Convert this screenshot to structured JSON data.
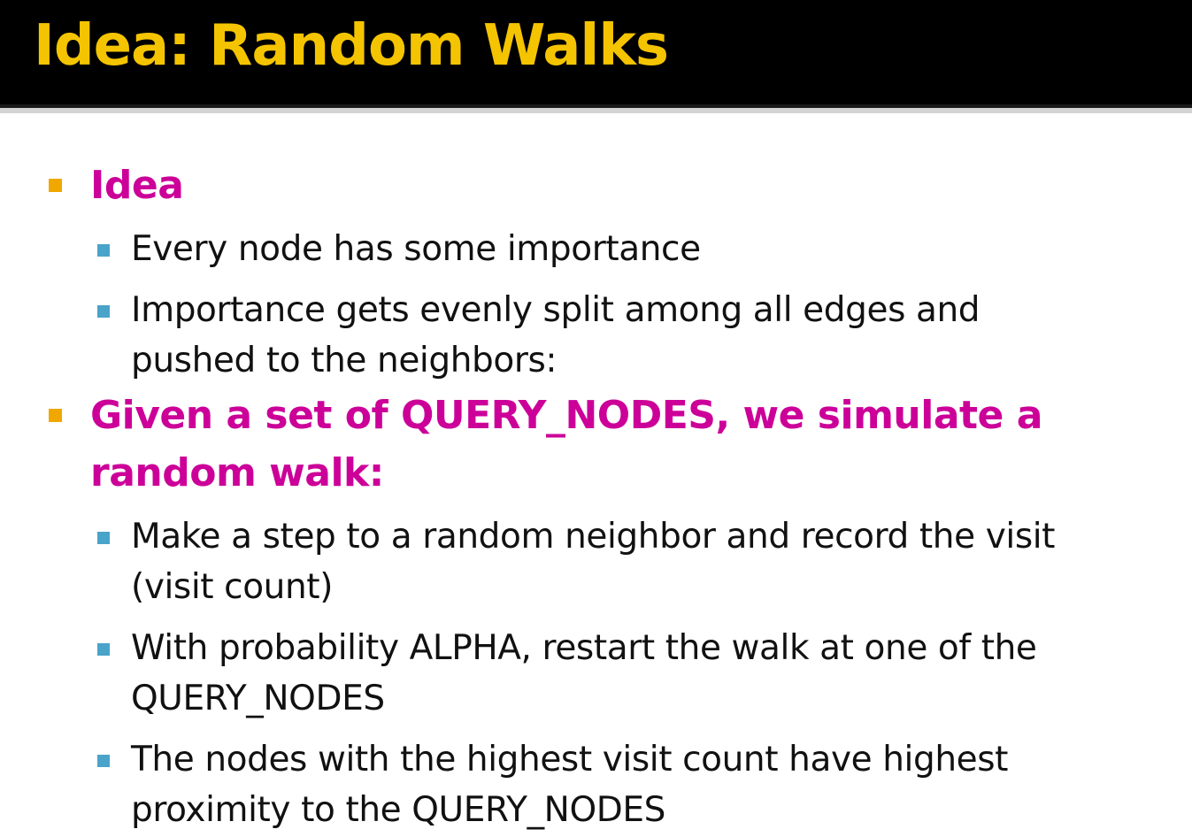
{
  "slide": {
    "title": "Idea: Random Walks",
    "colors": {
      "title_text": "#f5c400",
      "title_background": "#000000",
      "level1_text": "#cc0099",
      "level1_bullet": "#f0a800",
      "level2_bullet": "#4aa3c9",
      "body_text": "#111111"
    },
    "bullets": [
      {
        "lines": [
          "Idea"
        ],
        "children": [
          {
            "lines": [
              "Every node has some importance"
            ]
          },
          {
            "lines": [
              "Importance gets evenly split among all edges and",
              "pushed to the neighbors:"
            ]
          }
        ]
      },
      {
        "lines": [
          "Given a set of QUERY_NODES, we simulate a",
          "random walk:"
        ],
        "children": [
          {
            "lines": [
              "Make a step to a random neighbor and record the visit",
              "(visit count)"
            ]
          },
          {
            "lines": [
              "With probability ALPHA, restart the walk at one of the",
              "QUERY_NODES"
            ]
          },
          {
            "lines": [
              "The nodes with the highest visit count have highest",
              "proximity to the QUERY_NODES"
            ]
          }
        ]
      }
    ]
  }
}
